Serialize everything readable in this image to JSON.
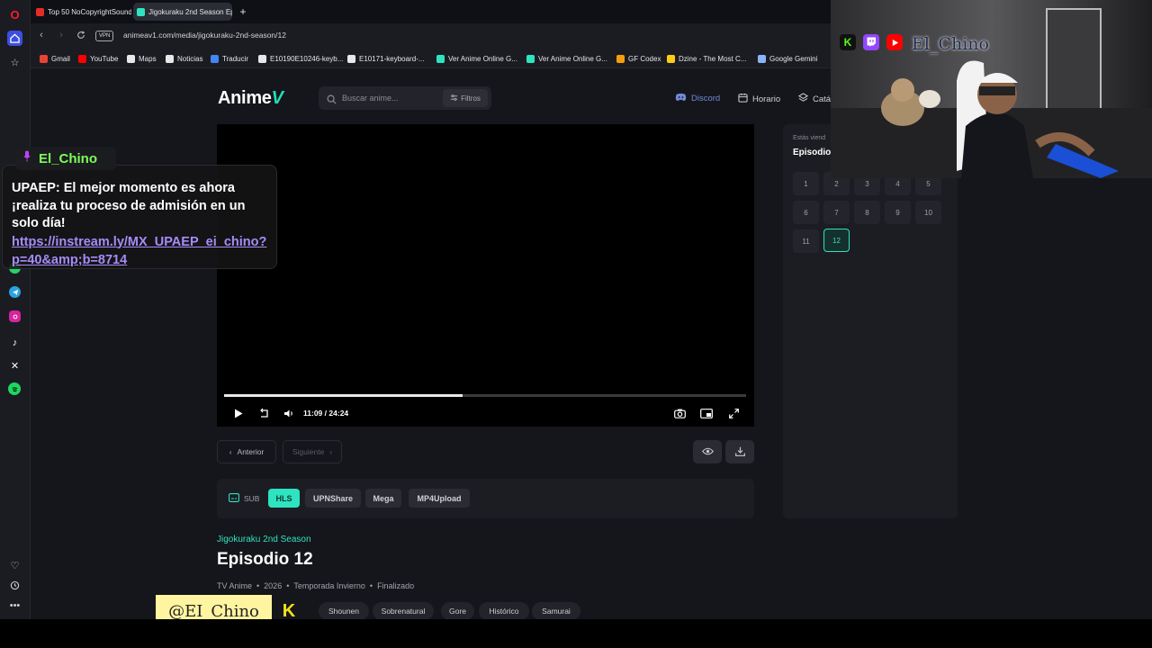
{
  "browser": {
    "tabs": [
      {
        "label": "Top 50 NoCopyrightSounds",
        "favicon_color": "#e52d27"
      },
      {
        "label": "Jigokuraku 2nd Season Ep",
        "favicon_color": "#2ee3c0"
      }
    ],
    "new_tab": "+",
    "vpn_label": "VPN",
    "url": "animeav1.com/media/jigokuraku-2nd-season/12",
    "bookmarks": [
      {
        "label": "Gmail",
        "icon_color": "#ea4335"
      },
      {
        "label": "YouTube",
        "icon_color": "#ff0000"
      },
      {
        "label": "Maps",
        "icon_color": "#e8e8e8"
      },
      {
        "label": "Noticias",
        "icon_color": "#e8e8e8"
      },
      {
        "label": "Traducir",
        "icon_color": "#4285f4"
      },
      {
        "label": "E10190E10246-keyb...",
        "icon_color": "#e8e8e8"
      },
      {
        "label": "E10171-keyboard-...",
        "icon_color": "#e8e8e8"
      },
      {
        "label": "Ver Anime Online G...",
        "icon_color": "#2ee3c0"
      },
      {
        "label": "Ver Anime Online G...",
        "icon_color": "#2ee3c0"
      },
      {
        "label": "GF Codex",
        "icon_color": "#f59e0b"
      },
      {
        "label": "Dzine - The Most C...",
        "icon_color": "#facc15"
      },
      {
        "label": "Google Gemini",
        "icon_color": "#8ab4f8"
      }
    ]
  },
  "site": {
    "logo_text": "Anime",
    "logo_mark": "V",
    "search_placeholder": "Buscar anime...",
    "filters_label": "Filtros",
    "nav": {
      "discord": "Discord",
      "horario": "Horario",
      "catalogo": "Catá"
    }
  },
  "player": {
    "current_time": "11:09",
    "separator": "/",
    "duration": "24:24",
    "progress_fraction": 0.457
  },
  "episode_nav": {
    "prev": "Anterior",
    "next": "Siguiente"
  },
  "servers": {
    "sub_label": "SUB",
    "items": [
      {
        "label": "HLS",
        "active": true
      },
      {
        "label": "UPNShare",
        "active": false
      },
      {
        "label": "Mega",
        "active": false
      },
      {
        "label": "MP4Upload",
        "active": false
      }
    ]
  },
  "anime": {
    "series": "Jigokuraku 2nd Season",
    "episode_title": "Episodio 12",
    "meta": [
      "TV Anime",
      "2026",
      "Temporada Invierno",
      "Finalizado"
    ],
    "genres": [
      "Shounen",
      "Sobrenatural",
      "Gore",
      "Histórico",
      "Samurai"
    ]
  },
  "episodes_panel": {
    "watching_label": "Estás viend",
    "current_label": "Episodio",
    "episodes": [
      "1",
      "2",
      "3",
      "4",
      "5",
      "6",
      "7",
      "8",
      "9",
      "10",
      "11",
      "12"
    ],
    "active": "12"
  },
  "chat": {
    "username": "El_Chino",
    "message": "UPAEP: El mejor momento es ahora ¡realiza tu proceso de admisión en un solo día!",
    "link": "https://instream.ly/MX_UPAEP_ei_chino?p=40&amp;b=8714"
  },
  "stream_overlay": {
    "webcam_name": "El_Chino",
    "handle": "@EI_Chino",
    "kick_mark": "K",
    "twitch_color": "#9146ff",
    "youtube_color": "#ff0000",
    "kick_color": "#53fc18"
  },
  "colors": {
    "accent": "#2ee3c0",
    "background": "#15161b"
  }
}
